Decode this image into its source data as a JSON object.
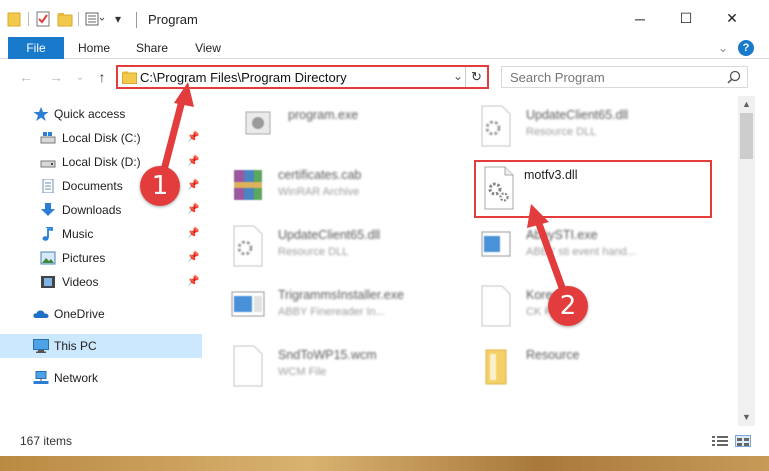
{
  "window": {
    "title": "Program",
    "minimize_glyph": "─",
    "maximize_glyph": "☐",
    "close_glyph": "✕"
  },
  "ribbon": {
    "tabs": [
      "File",
      "Home",
      "Share",
      "View"
    ],
    "expand_glyph": "⌄",
    "help_glyph": "?"
  },
  "address_bar": {
    "path": "C:\\Program Files\\Program Directory",
    "dropdown_glyph": "⌄",
    "refresh_glyph": "↻"
  },
  "search": {
    "placeholder": "Search Program"
  },
  "sidebar": {
    "items": [
      {
        "label": "Quick access",
        "icon": "star-icon",
        "pinned": false
      },
      {
        "label": "Local Disk (C:)",
        "icon": "drive-icon",
        "pinned": true
      },
      {
        "label": "Local Disk (D:)",
        "icon": "drive-icon",
        "pinned": true
      },
      {
        "label": "Documents",
        "icon": "documents-icon",
        "pinned": true
      },
      {
        "label": "Downloads",
        "icon": "downloads-icon",
        "pinned": true
      },
      {
        "label": "Music",
        "icon": "music-icon",
        "pinned": true
      },
      {
        "label": "Pictures",
        "icon": "pictures-icon",
        "pinned": true
      },
      {
        "label": "Videos",
        "icon": "videos-icon",
        "pinned": true
      },
      {
        "label": "OneDrive",
        "icon": "cloud-icon",
        "pinned": false
      },
      {
        "label": "This PC",
        "icon": "computer-icon",
        "pinned": false,
        "selected": true
      },
      {
        "label": "Network",
        "icon": "network-icon",
        "pinned": false
      }
    ],
    "pin_glyph": "📌"
  },
  "files": [
    {
      "name": "program.exe",
      "type": "",
      "icon": "exe-icon"
    },
    {
      "name": "UpdateClient65.dll",
      "type": "Resource DLL",
      "icon": "dll-icon"
    },
    {
      "name": "certificates.cab",
      "type": "WinRAR Archive",
      "icon": "archive-icon"
    },
    {
      "name": "motfv3.dll",
      "type": "",
      "icon": "dll-icon"
    },
    {
      "name": "UpdateClient65.dll",
      "type": "Resource DLL",
      "icon": "dll-icon"
    },
    {
      "name": "AbbySTI.exe",
      "type": "ABBY sti event hand...",
      "icon": "exe-icon"
    },
    {
      "name": "TrigrammsInstaller.exe",
      "type": "ABBY Finereader In...",
      "icon": "installer-icon"
    },
    {
      "name": "Koreal.jpk",
      "type": "CK File",
      "icon": "file-icon"
    },
    {
      "name": "SndToWP15.wcm",
      "type": "WCM File",
      "icon": "file-icon"
    },
    {
      "name": "Resource",
      "type": "",
      "icon": "folder-icon"
    }
  ],
  "status": {
    "item_count": "167 items"
  },
  "callouts": [
    "1",
    "2"
  ],
  "colors": {
    "accent": "#1979ca",
    "highlight": "#e23c3c",
    "selected_bg": "#cce8ff"
  }
}
